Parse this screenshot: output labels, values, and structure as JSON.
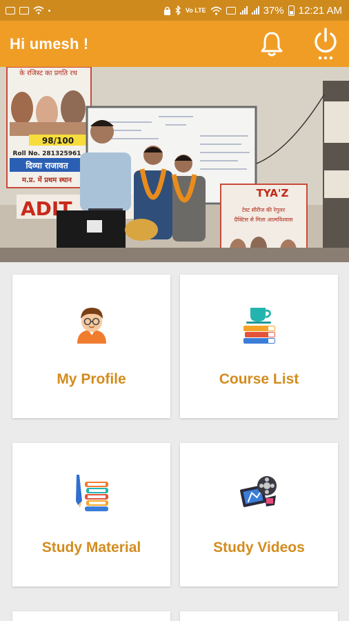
{
  "status_bar": {
    "battery": "37%",
    "time": "12:21 AM",
    "volte": "Vo LTE",
    "network": "LTE"
  },
  "header": {
    "greeting": "Hi umesh !",
    "notification_icon": "bell-icon",
    "logout_icon": "power-icon"
  },
  "banner": {
    "poster_score": "98/100",
    "poster_roll": "Roll No. 281325961",
    "poster_name": "दिव्या राजावत",
    "poster_rank": "म.प्र. में प्रथम स्थान",
    "poster_top": "के रजिस्ट का प्रगति रथ",
    "sign_left": "ADIT",
    "sign_right": "TYA'Z",
    "sign_right_line1": "टेस्ट सीरीज की रेगुलर",
    "sign_right_line2": "प्रैक्टिस से मिला आत्मविश्वास"
  },
  "menu": [
    {
      "label": "My Profile",
      "icon": "student-avatar-icon"
    },
    {
      "label": "Course List",
      "icon": "books-cup-icon"
    },
    {
      "label": "Study Material",
      "icon": "books-pencil-icon"
    },
    {
      "label": "Study Videos",
      "icon": "film-reel-icon"
    }
  ],
  "colors": {
    "status_bar": "#cf8a1e",
    "app_bar": "#f09d26",
    "accent_text": "#d38c1e",
    "background": "#ebebeb"
  }
}
